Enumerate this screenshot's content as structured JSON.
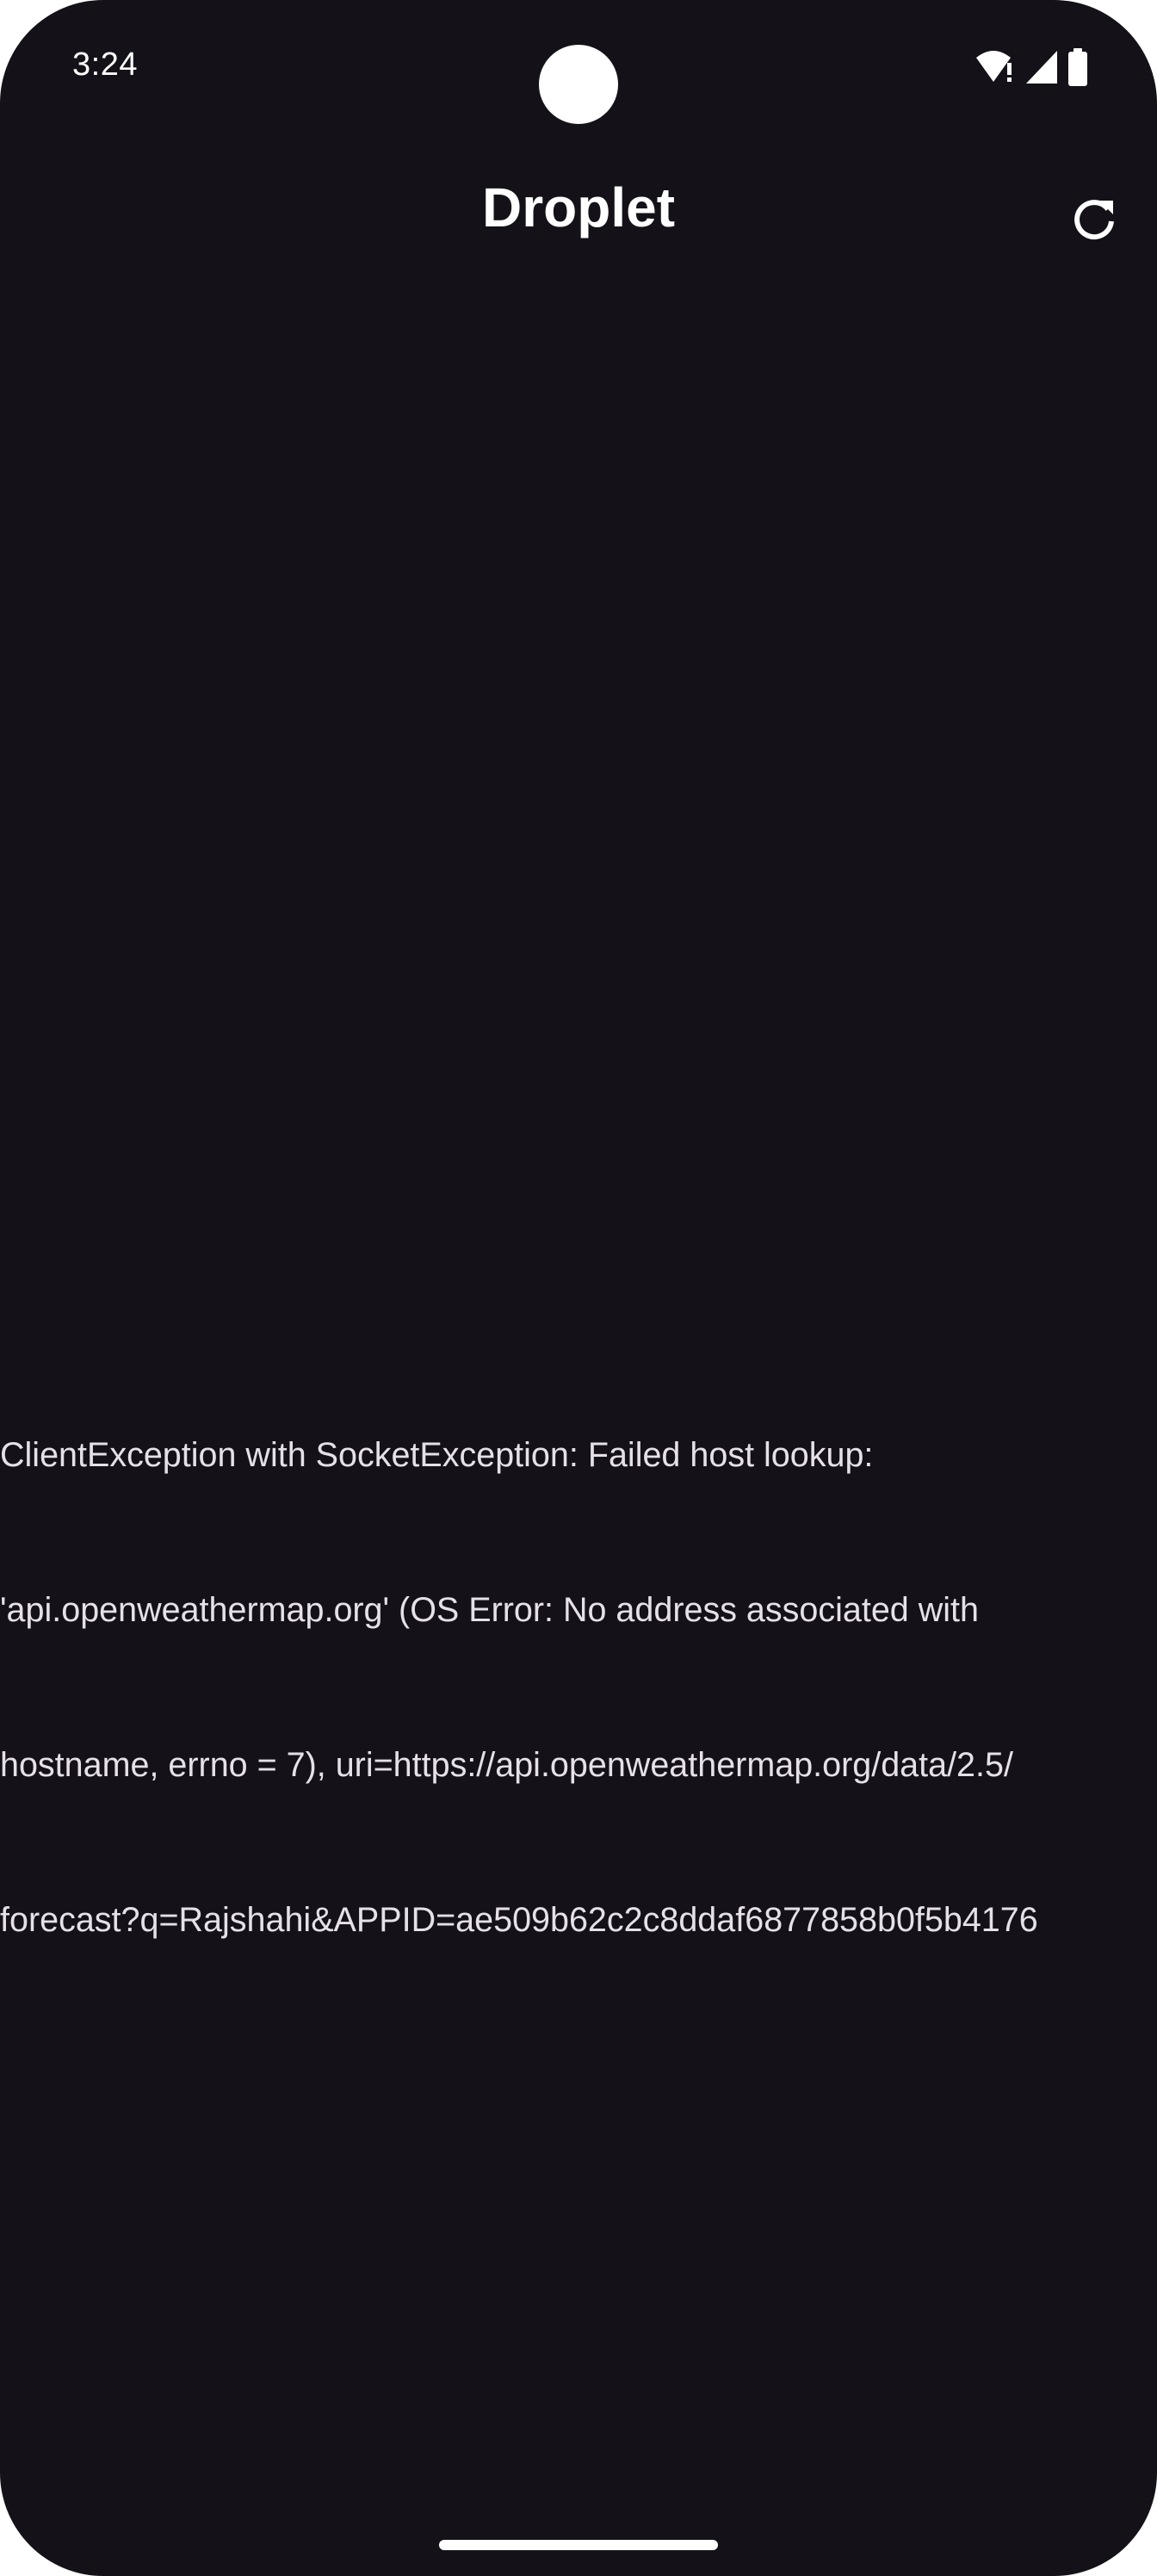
{
  "status_bar": {
    "time": "3:24",
    "icons": [
      "wifi-alert-icon",
      "signal-icon",
      "battery-icon"
    ]
  },
  "app_bar": {
    "title": "Droplet",
    "actions": [
      "refresh-icon"
    ]
  },
  "error": {
    "lines": [
      "ClientException with SocketException: Failed host lookup:",
      "'api.openweathermap.org' (OS Error: No address associated with",
      "hostname, errno = 7), uri=https://api.openweathermap.org/data/2.5/",
      "forecast?q=Rajshahi&APPID=ae509b62c2c8ddaf6877858b0f5b4176"
    ]
  },
  "colors": {
    "background": "#141218",
    "text_primary": "#ffffff",
    "text_error": "#e6e0e9"
  }
}
